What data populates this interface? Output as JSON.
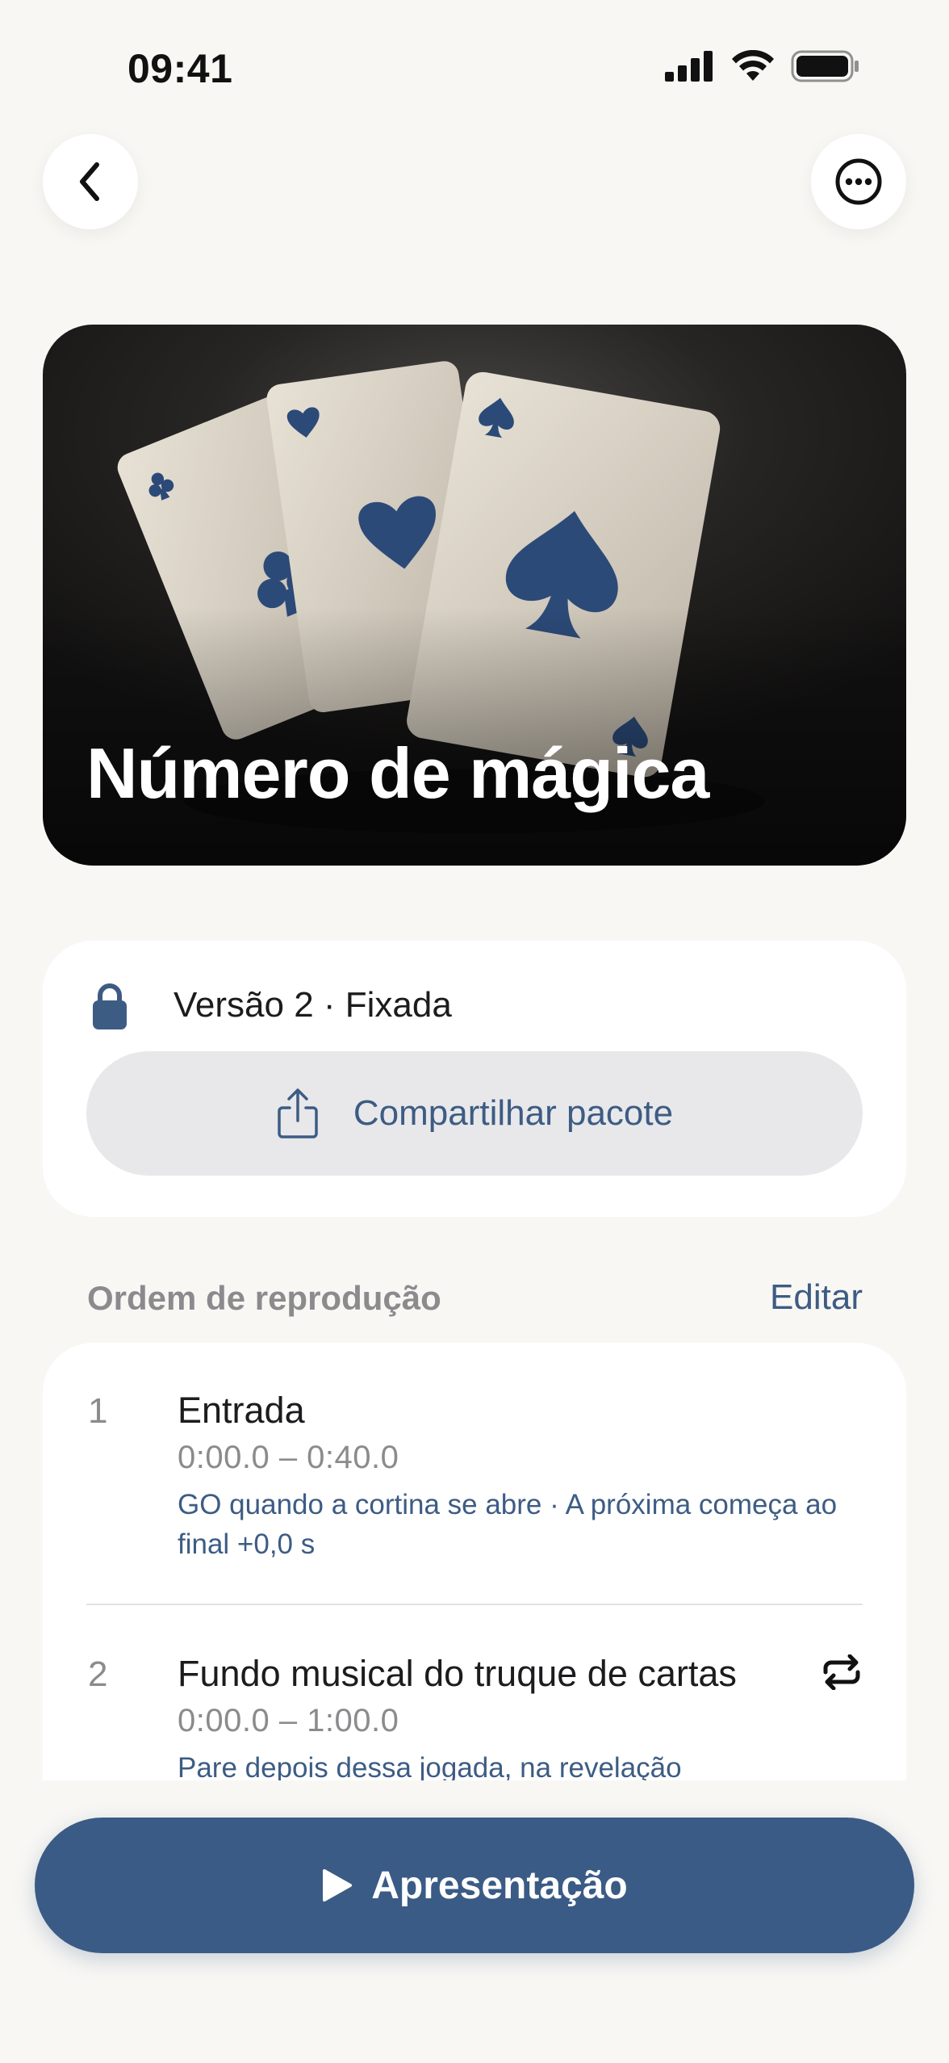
{
  "status_bar": {
    "time": "09:41"
  },
  "nav": {
    "back_icon": "chevron-left-icon",
    "more_icon": "ellipsis-circle-icon"
  },
  "hero": {
    "title": "Número de mágica"
  },
  "version": {
    "label": "Versão 2 · Fixada",
    "share_label": "Compartilhar pacote"
  },
  "playlist": {
    "section_title": "Ordem de reprodução",
    "edit_label": "Editar",
    "items": [
      {
        "number": "1",
        "title": "Entrada",
        "time": "0:00.0 – 0:40.0",
        "note": "GO quando a cortina se abre · A próxima começa ao final +0,0 s",
        "loop": false
      },
      {
        "number": "2",
        "title": "Fundo musical do truque de cartas",
        "time": "0:00.0 – 1:00.0",
        "note": "Pare depois dessa jogada, na revelação",
        "loop": true
      }
    ]
  },
  "play_button": {
    "label": "Apresentação"
  },
  "colors": {
    "accent": "#3a5b85",
    "link": "#3d5c84",
    "background": "#f8f7f4"
  }
}
